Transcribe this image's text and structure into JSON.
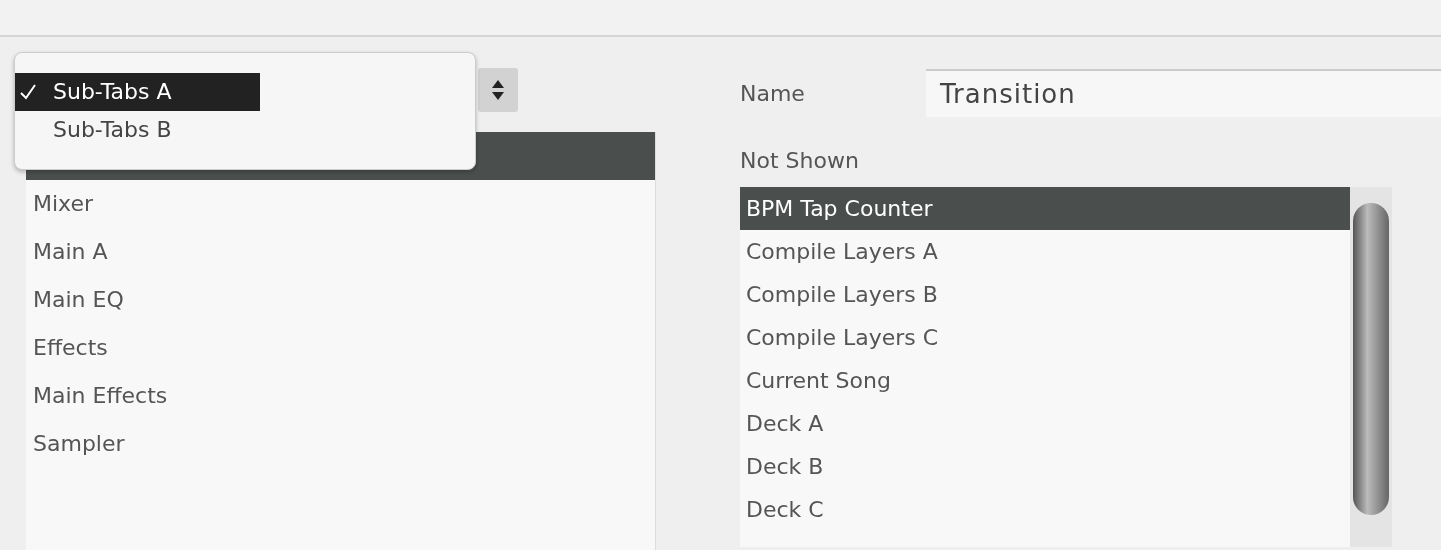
{
  "sub_tabs_menu": {
    "options": [
      {
        "label": "Sub-Tabs A",
        "selected": true
      },
      {
        "label": "Sub-Tabs B",
        "selected": false
      }
    ]
  },
  "left_list": {
    "covered_selected_row": true,
    "items": [
      {
        "label": "Mixer",
        "selected": false
      },
      {
        "label": "Main A",
        "selected": false
      },
      {
        "label": "Main EQ",
        "selected": false
      },
      {
        "label": "Effects",
        "selected": false
      },
      {
        "label": "Main Effects",
        "selected": false
      },
      {
        "label": "Sampler",
        "selected": false
      }
    ]
  },
  "name_field": {
    "label": "Name",
    "value": "Transition"
  },
  "not_shown": {
    "label": "Not Shown",
    "items": [
      {
        "label": "BPM Tap Counter",
        "selected": true
      },
      {
        "label": "Compile Layers A",
        "selected": false
      },
      {
        "label": "Compile Layers B",
        "selected": false
      },
      {
        "label": "Compile Layers C",
        "selected": false
      },
      {
        "label": "Current Song",
        "selected": false
      },
      {
        "label": "Deck A",
        "selected": false
      },
      {
        "label": "Deck B",
        "selected": false
      },
      {
        "label": "Deck C",
        "selected": false
      }
    ]
  }
}
